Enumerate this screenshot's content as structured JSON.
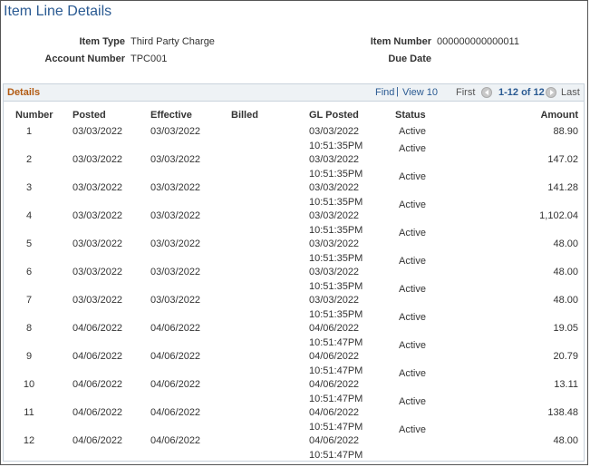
{
  "page": {
    "title": "Item Line Details"
  },
  "fields": {
    "item_type_label": "Item Type",
    "item_type_value": "Third Party Charge",
    "account_number_label": "Account Number",
    "account_number_value": "TPC001",
    "item_number_label": "Item Number",
    "item_number_value": "000000000000011",
    "due_date_label": "Due Date",
    "due_date_value": ""
  },
  "grid": {
    "title": "Details",
    "find_label": "Find",
    "separator": "|",
    "view_label": "View 10",
    "first_label": "First",
    "range_label": "1-12 of 12",
    "last_label": "Last",
    "columns": [
      "Number",
      "Posted",
      "Effective",
      "Billed",
      "GL Posted",
      "Status",
      "Amount"
    ],
    "rows": [
      {
        "number": "1",
        "posted": "03/03/2022",
        "effective": "03/03/2022",
        "billed": "",
        "gl_date": "03/03/2022",
        "gl_time": "10:51:35PM",
        "status": "Active",
        "amount": "88.90"
      },
      {
        "number": "2",
        "posted": "03/03/2022",
        "effective": "03/03/2022",
        "billed": "",
        "gl_date": "03/03/2022",
        "gl_time": "10:51:35PM",
        "status": "Active",
        "amount": "147.02"
      },
      {
        "number": "3",
        "posted": "03/03/2022",
        "effective": "03/03/2022",
        "billed": "",
        "gl_date": "03/03/2022",
        "gl_time": "10:51:35PM",
        "status": "Active",
        "amount": "141.28"
      },
      {
        "number": "4",
        "posted": "03/03/2022",
        "effective": "03/03/2022",
        "billed": "",
        "gl_date": "03/03/2022",
        "gl_time": "10:51:35PM",
        "status": "Active",
        "amount": "1,102.04"
      },
      {
        "number": "5",
        "posted": "03/03/2022",
        "effective": "03/03/2022",
        "billed": "",
        "gl_date": "03/03/2022",
        "gl_time": "10:51:35PM",
        "status": "Active",
        "amount": "48.00"
      },
      {
        "number": "6",
        "posted": "03/03/2022",
        "effective": "03/03/2022",
        "billed": "",
        "gl_date": "03/03/2022",
        "gl_time": "10:51:35PM",
        "status": "Active",
        "amount": "48.00"
      },
      {
        "number": "7",
        "posted": "03/03/2022",
        "effective": "03/03/2022",
        "billed": "",
        "gl_date": "03/03/2022",
        "gl_time": "10:51:35PM",
        "status": "Active",
        "amount": "48.00"
      },
      {
        "number": "8",
        "posted": "04/06/2022",
        "effective": "04/06/2022",
        "billed": "",
        "gl_date": "04/06/2022",
        "gl_time": "10:51:47PM",
        "status": "Active",
        "amount": "19.05"
      },
      {
        "number": "9",
        "posted": "04/06/2022",
        "effective": "04/06/2022",
        "billed": "",
        "gl_date": "04/06/2022",
        "gl_time": "10:51:47PM",
        "status": "Active",
        "amount": "20.79"
      },
      {
        "number": "10",
        "posted": "04/06/2022",
        "effective": "04/06/2022",
        "billed": "",
        "gl_date": "04/06/2022",
        "gl_time": "10:51:47PM",
        "status": "Active",
        "amount": "13.11"
      },
      {
        "number": "11",
        "posted": "04/06/2022",
        "effective": "04/06/2022",
        "billed": "",
        "gl_date": "04/06/2022",
        "gl_time": "10:51:47PM",
        "status": "Active",
        "amount": "138.48"
      },
      {
        "number": "12",
        "posted": "04/06/2022",
        "effective": "04/06/2022",
        "billed": "",
        "gl_date": "04/06/2022",
        "gl_time": "10:51:47PM",
        "status": "Active",
        "amount": "48.00"
      }
    ]
  }
}
